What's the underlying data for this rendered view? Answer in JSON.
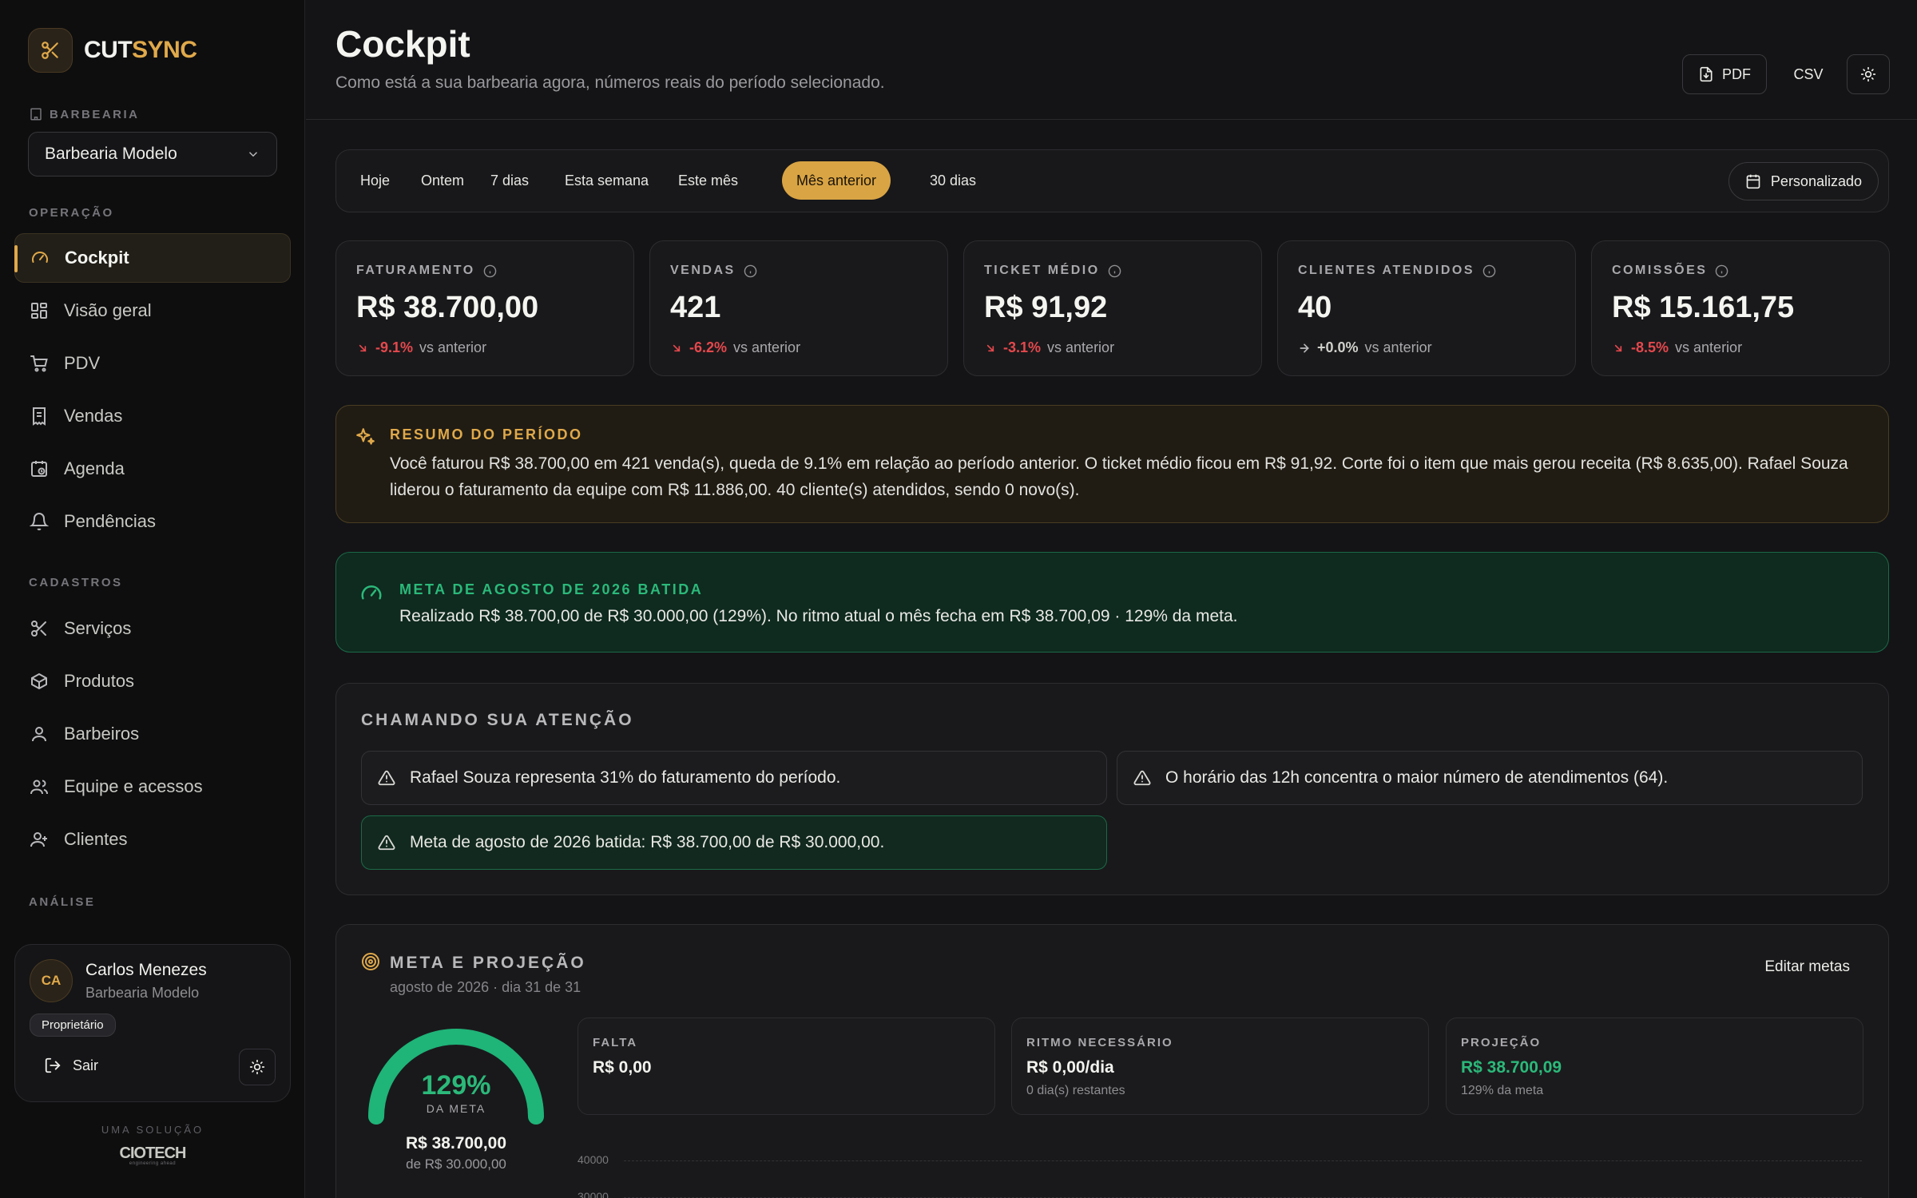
{
  "brand": {
    "part1": "CUT",
    "part2": "SYNC"
  },
  "sidebar": {
    "barbershop_label": "BARBEARIA",
    "barbershop_selected": "Barbearia Modelo",
    "sections": {
      "operacao": "OPERAÇÃO",
      "cadastros": "CADASTROS",
      "analise": "ANÁLISE"
    },
    "operacao_items": [
      {
        "label": "Cockpit",
        "icon": "gauge-icon",
        "active": true
      },
      {
        "label": "Visão geral",
        "icon": "grid-icon"
      },
      {
        "label": "PDV",
        "icon": "cart-icon"
      },
      {
        "label": "Vendas",
        "icon": "receipt-icon"
      },
      {
        "label": "Agenda",
        "icon": "calendar-clock-icon"
      },
      {
        "label": "Pendências",
        "icon": "bell-icon"
      }
    ],
    "cadastros_items": [
      {
        "label": "Serviços",
        "icon": "scissors-icon"
      },
      {
        "label": "Produtos",
        "icon": "box-icon"
      },
      {
        "label": "Barbeiros",
        "icon": "user-icon"
      },
      {
        "label": "Equipe e acessos",
        "icon": "users-icon"
      },
      {
        "label": "Clientes",
        "icon": "clients-icon"
      }
    ],
    "user": {
      "initials": "CA",
      "name": "Carlos Menezes",
      "org": "Barbearia Modelo",
      "role": "Proprietário",
      "logout": "Sair"
    },
    "solution_label": "UMA SOLUÇÃO",
    "solution_logo": "CIOTECH",
    "solution_tagline": "engineering ahead"
  },
  "header": {
    "title": "Cockpit",
    "subtitle": "Como está a sua barbearia agora, números reais do período selecionado.",
    "pdf": "PDF",
    "csv": "CSV"
  },
  "periods": {
    "options": [
      "Hoje",
      "Ontem",
      "7 dias",
      "Esta semana",
      "Este mês",
      "Mês anterior",
      "30 dias"
    ],
    "selected": "Mês anterior",
    "custom": "Personalizado"
  },
  "kpis": [
    {
      "label": "FATURAMENTO",
      "value": "R$ 38.700,00",
      "delta": "-9.1%",
      "trend": "down",
      "suffix": "vs anterior"
    },
    {
      "label": "VENDAS",
      "value": "421",
      "delta": "-6.2%",
      "trend": "down",
      "suffix": "vs anterior"
    },
    {
      "label": "TICKET MÉDIO",
      "value": "R$ 91,92",
      "delta": "-3.1%",
      "trend": "down",
      "suffix": "vs anterior"
    },
    {
      "label": "CLIENTES ATENDIDOS",
      "value": "40",
      "delta": "+0.0%",
      "trend": "flat",
      "suffix": "vs anterior"
    },
    {
      "label": "COMISSÕES",
      "value": "R$ 15.161,75",
      "delta": "-8.5%",
      "trend": "down",
      "suffix": "vs anterior"
    }
  ],
  "summary": {
    "title": "RESUMO DO PERÍODO",
    "text": "Você faturou R$ 38.700,00 em 421 venda(s), queda de 9.1% em relação ao período anterior. O ticket médio ficou em R$ 91,92. Corte foi o item que mais gerou receita (R$ 8.635,00). Rafael Souza liderou o faturamento da equipe com R$ 11.886,00. 40 cliente(s) atendidos, sendo 0 novo(s)."
  },
  "goal_banner": {
    "title": "META DE AGOSTO DE 2026 BATIDA",
    "text": "Realizado R$ 38.700,00 de R$ 30.000,00 (129%). No ritmo atual o mês fecha em R$ 38.700,09 · 129% da meta."
  },
  "attention": {
    "title": "CHAMANDO SUA ATENÇÃO",
    "alerts": [
      {
        "text": "Rafael Souza representa 31% do faturamento do período.",
        "tone": "neutral"
      },
      {
        "text": "O horário das 12h concentra o maior número de atendimentos (64).",
        "tone": "neutral"
      },
      {
        "text": "Meta de agosto de 2026 batida: R$ 38.700,00 de R$ 30.000,00.",
        "tone": "success"
      }
    ]
  },
  "meta": {
    "title": "META E PROJEÇÃO",
    "subtitle": "agosto de 2026 · dia 31 de 31",
    "edit": "Editar metas",
    "gauge_pct": "129%",
    "gauge_fraction": 1.0,
    "gauge_caption": "DA META",
    "gauge_value": "R$ 38.700,00",
    "gauge_of": "de R$ 30.000,00",
    "stats": [
      {
        "label": "FALTA",
        "value": "R$ 0,00",
        "sub": "",
        "tone": "normal"
      },
      {
        "label": "RITMO NECESSÁRIO",
        "value": "R$ 0,00/dia",
        "sub": "0 dia(s) restantes",
        "tone": "normal"
      },
      {
        "label": "PROJEÇÃO",
        "value": "R$ 38.700,09",
        "sub": "129% da meta",
        "tone": "green"
      }
    ],
    "axis_ticks": [
      "40000",
      "30000"
    ]
  },
  "colors": {
    "accent": "#e0a94a",
    "success": "#2bb97a",
    "danger": "#e5484d",
    "background": "#141416"
  }
}
